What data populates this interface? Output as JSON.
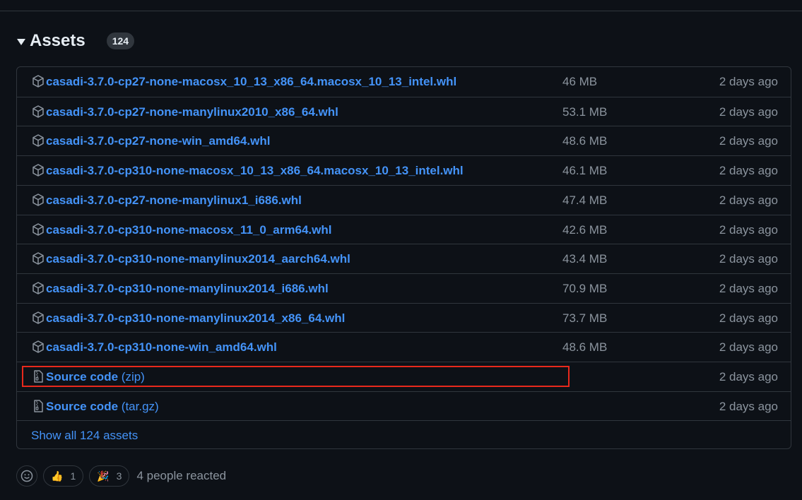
{
  "assets": {
    "title": "Assets",
    "count": "124",
    "rows": [
      {
        "name": "casadi-3.7.0-cp27-none-macosx_10_13_x86_64.macosx_10_13_intel.whl",
        "size": "46 MB",
        "date": "2 days ago",
        "icon": "package-icon"
      },
      {
        "name": "casadi-3.7.0-cp27-none-manylinux2010_x86_64.whl",
        "size": "53.1 MB",
        "date": "2 days ago",
        "icon": "package-icon"
      },
      {
        "name": "casadi-3.7.0-cp27-none-win_amd64.whl",
        "size": "48.6 MB",
        "date": "2 days ago",
        "icon": "package-icon"
      },
      {
        "name": "casadi-3.7.0-cp310-none-macosx_10_13_x86_64.macosx_10_13_intel.whl",
        "size": "46.1 MB",
        "date": "2 days ago",
        "icon": "package-icon"
      },
      {
        "name": "casadi-3.7.0-cp27-none-manylinux1_i686.whl",
        "size": "47.4 MB",
        "date": "2 days ago",
        "icon": "package-icon"
      },
      {
        "name": "casadi-3.7.0-cp310-none-macosx_11_0_arm64.whl",
        "size": "42.6 MB",
        "date": "2 days ago",
        "icon": "package-icon"
      },
      {
        "name": "casadi-3.7.0-cp310-none-manylinux2014_aarch64.whl",
        "size": "43.4 MB",
        "date": "2 days ago",
        "icon": "package-icon"
      },
      {
        "name": "casadi-3.7.0-cp310-none-manylinux2014_i686.whl",
        "size": "70.9 MB",
        "date": "2 days ago",
        "icon": "package-icon"
      },
      {
        "name": "casadi-3.7.0-cp310-none-manylinux2014_x86_64.whl",
        "size": "73.7 MB",
        "date": "2 days ago",
        "icon": "package-icon"
      },
      {
        "name": "casadi-3.7.0-cp310-none-win_amd64.whl",
        "size": "48.6 MB",
        "date": "2 days ago",
        "icon": "package-icon"
      }
    ],
    "source_rows": [
      {
        "name": "Source code",
        "suffix": "(zip)",
        "date": "2 days ago",
        "icon": "file-zip-icon"
      },
      {
        "name": "Source code",
        "suffix": "(tar.gz)",
        "date": "2 days ago",
        "icon": "file-zip-icon"
      }
    ],
    "show_all": "Show all 124 assets"
  },
  "reactions": {
    "picker_icon": "smiley-icon",
    "thumbs_emoji": "👍",
    "thumbs_count": "1",
    "tada_emoji": "🎉",
    "tada_count": "3",
    "summary": "4 people reacted"
  },
  "colors": {
    "background": "#0d1117",
    "border": "#30363d",
    "link": "#4493f8",
    "muted": "#8b949e",
    "highlight": "#e8291c"
  }
}
